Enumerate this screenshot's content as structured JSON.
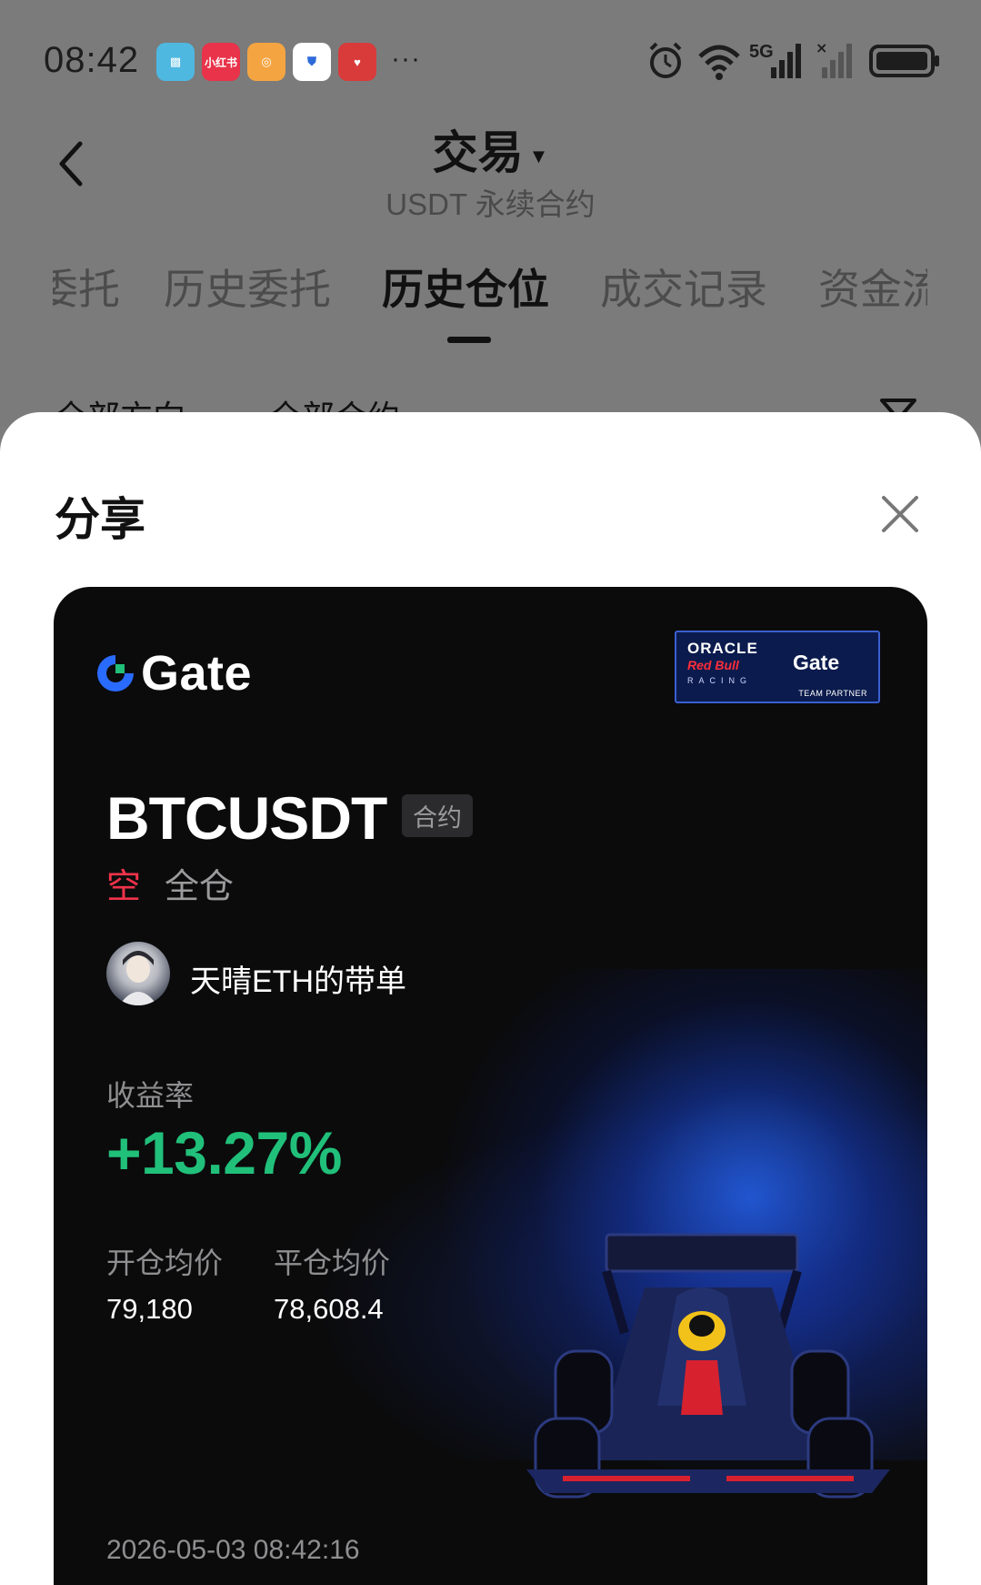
{
  "status_bar": {
    "time": "08:42",
    "app_icons": [
      "book-app",
      "xiaohongshu-app",
      "search-app",
      "shield-app",
      "promo-app"
    ],
    "xiaohongshu_label": "小红书",
    "network": "5G",
    "more": "···"
  },
  "header": {
    "title": "交易",
    "subtitle": "USDT 永续合约"
  },
  "tabs": [
    {
      "label": "委托",
      "active": false
    },
    {
      "label": "历史委托",
      "active": false
    },
    {
      "label": "历史仓位",
      "active": true
    },
    {
      "label": "成交记录",
      "active": false
    },
    {
      "label": "资金流",
      "active": false
    }
  ],
  "filters": [
    "全部方向",
    "全部合约"
  ],
  "share_sheet": {
    "title": "分享"
  },
  "card": {
    "brand": "Gate",
    "partner": {
      "line1": "ORACLE",
      "line2": "Red Bull",
      "line3": "RACING",
      "brand": "Gate",
      "footer": "TEAM PARTNER"
    },
    "symbol": "BTCUSDT",
    "tag": "合约",
    "side": "空",
    "margin_mode": "全仓",
    "trader": "天晴ETH的带单",
    "yield_label": "收益率",
    "yield_value": "+13.27%",
    "open_label": "开仓均价",
    "open_value": "79,180",
    "close_label": "平仓均价",
    "close_value": "78,608.4",
    "timestamp": "2026-05-03 08:42:16",
    "colors": {
      "short": "#f0334a",
      "profit": "#21c07a",
      "brand_blue": "#2a6bff"
    }
  }
}
